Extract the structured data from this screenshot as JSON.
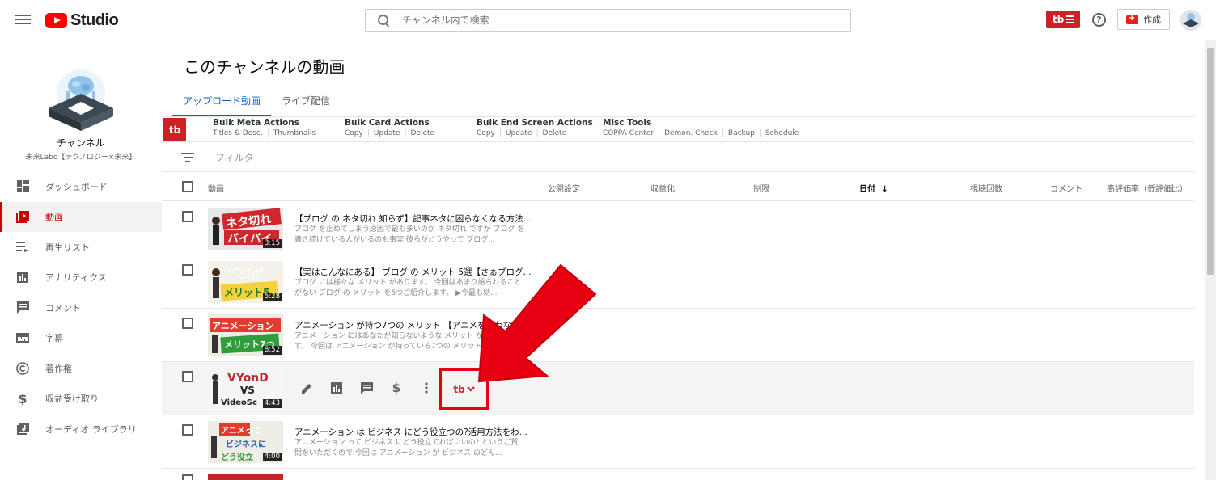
{
  "header": {
    "logo_text": "Studio",
    "search_placeholder": "チャンネル内で検索",
    "tubebuddy_badge": "tb",
    "help_symbol": "?",
    "create_label": "作成"
  },
  "sidebar": {
    "channel_label": "チャンネル",
    "channel_name": "未来Labo【テクノロジー×未来】",
    "items": [
      {
        "label": "ダッシュボード",
        "icon": "dashboard-icon"
      },
      {
        "label": "動画",
        "icon": "video-icon",
        "active": true
      },
      {
        "label": "再生リスト",
        "icon": "playlist-icon"
      },
      {
        "label": "アナリティクス",
        "icon": "analytics-icon"
      },
      {
        "label": "コメント",
        "icon": "comment-icon"
      },
      {
        "label": "字幕",
        "icon": "subtitles-icon"
      },
      {
        "label": "著作権",
        "icon": "copyright-icon"
      },
      {
        "label": "収益受け取り",
        "icon": "dollar-icon"
      },
      {
        "label": "オーディオ ライブラリ",
        "icon": "audio-library-icon"
      }
    ]
  },
  "main": {
    "title": "このチャンネルの動画",
    "tabs": [
      {
        "label": "アップロード動画",
        "active": true
      },
      {
        "label": "ライブ配信",
        "active": false
      }
    ]
  },
  "tubebuddy": {
    "logo": "tb",
    "groups": [
      {
        "title": "Bulk Meta Actions",
        "links": [
          "Titles & Desc.",
          "Thumbnails"
        ]
      },
      {
        "title": "Bulk Card Actions",
        "links": [
          "Copy",
          "Update",
          "Delete"
        ]
      },
      {
        "title": "Bulk End Screen Actions",
        "links": [
          "Copy",
          "Update",
          "Delete"
        ]
      },
      {
        "title": "Misc Tools",
        "links": [
          "COPPA Center",
          "Demon. Check",
          "Backup",
          "Schedule"
        ]
      }
    ],
    "row_menu_label": "tb"
  },
  "filter": {
    "placeholder": "フィルタ"
  },
  "table": {
    "columns": [
      "動画",
      "公開設定",
      "収益化",
      "制限",
      "日付",
      "視聴回数",
      "コメント",
      "高評価率（低評価比）"
    ],
    "sort_indicator": "↓",
    "rows": [
      {
        "title": "【ブログ の ネタ切れ 知らず】記事ネタに困らなくなる方法...",
        "desc": "ブログ を止めてしまう原因で最も多いのが ネタ切れ ですが ブログ を書き続けている人がいるのも事実 彼らがどうやって ブログ...",
        "duration": "3:15",
        "thumb_text": [
          "ネタ切れ",
          "バイバイ"
        ],
        "thumb_colors": [
          "#e8e8e8",
          "#d0262d"
        ]
      },
      {
        "title": "【実はこんなにある】 ブログ の メリット 5選【さぁブログ...",
        "desc": "ブログ には様々な メリット があります。 今回はあまり語られることがない ブログ の メリット を5つご紹介します。 ▶今最も効...",
        "duration": "5:28",
        "thumb_text": [
          "ブログ",
          "メリット5"
        ],
        "thumb_colors": [
          "#f3f1e8",
          "#2e9d3a"
        ]
      },
      {
        "title": "アニメーション が持つ7つの メリット 【アニメを使わない...",
        "desc": "アニメーション にはあなたが知らないような メリット がありま ります。 今回は アニメーション が持っている7つの メリット...",
        "duration": "8:52",
        "thumb_text": [
          "アニメーション",
          "メリット7つ"
        ],
        "thumb_colors": [
          "#ecebe4",
          "#e53b2f"
        ]
      },
      {
        "title": "",
        "desc": "",
        "duration": "4:43",
        "thumb_text": [
          "VYonD",
          "VS",
          "VideoSc"
        ],
        "thumb_colors": [
          "#f5f5f5",
          "#c0272d"
        ]
      },
      {
        "title": "アニメーション は ビジネス にどう役立つの?活用方法をわ...",
        "desc": "アニメーション って ビジネス にどう役立てればいいの? というご質問をいただくので 今回は アニメーション が ビジネス のどん...",
        "duration": "4:00",
        "thumb_text": [
          "アニメって",
          "ビジネスに",
          "どう役立"
        ],
        "thumb_colors": [
          "#eeede6",
          "#e53b2f"
        ]
      }
    ]
  },
  "colors": {
    "youtube_red": "#ff0000",
    "tubebuddy_red": "#cc2127",
    "active_tab_blue": "#065fd4",
    "annotation_arrow": "#ff0000"
  }
}
